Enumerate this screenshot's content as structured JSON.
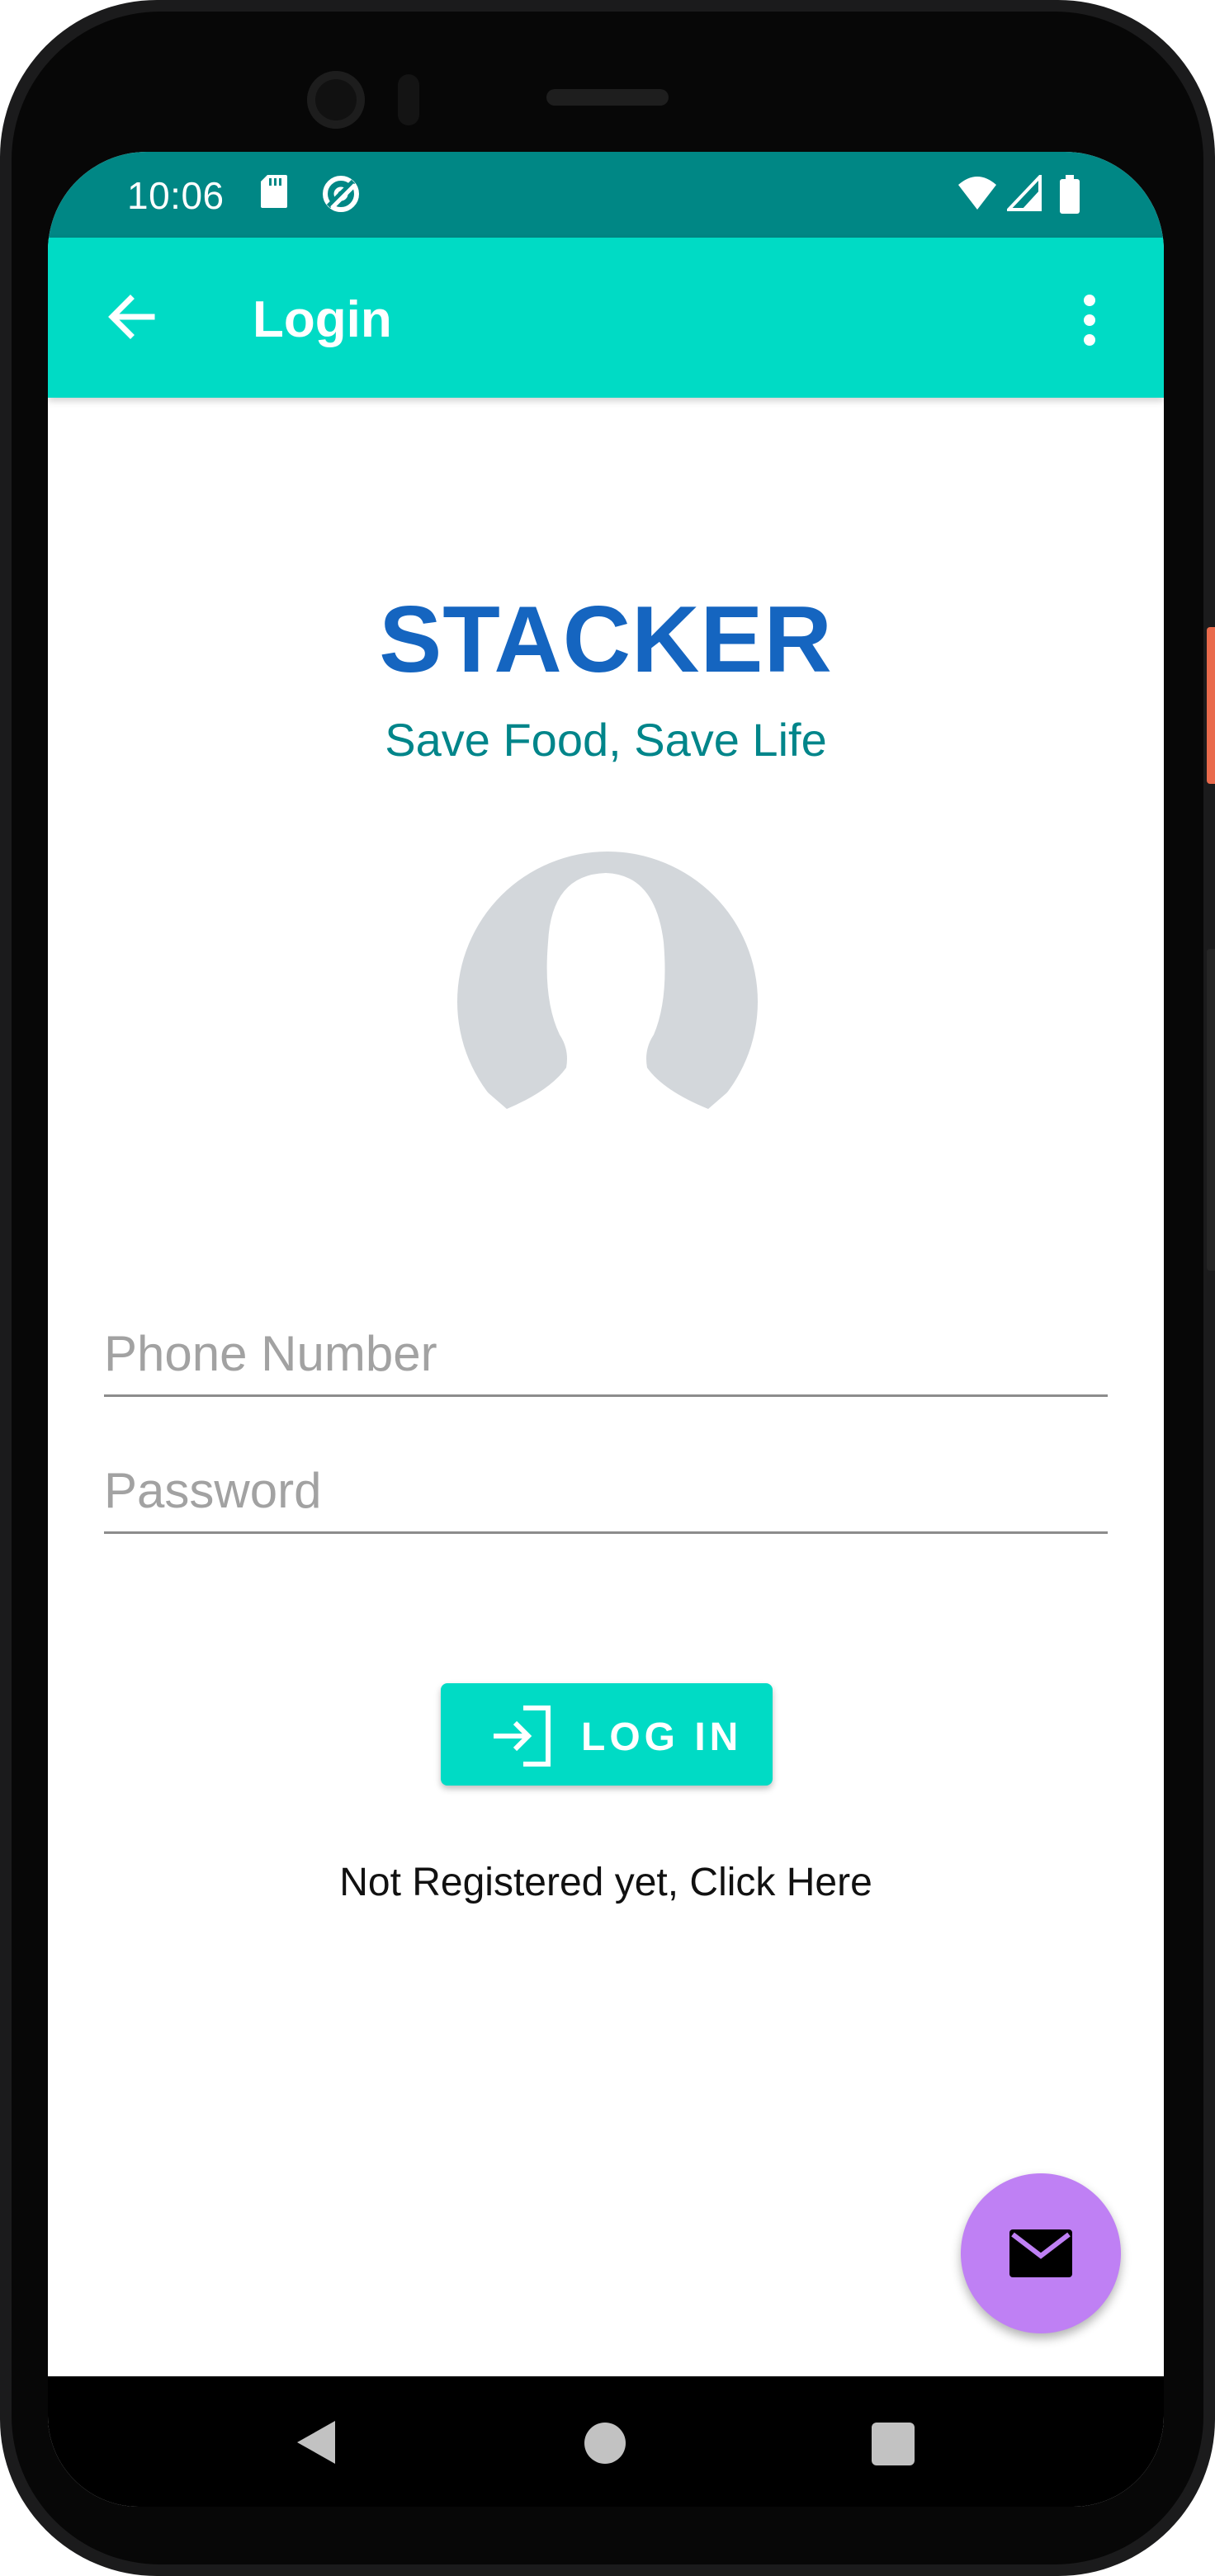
{
  "status_bar": {
    "time": "10:06",
    "left_icons": [
      "sd-card-icon",
      "data-saver-icon"
    ],
    "right_icons": [
      "wifi-icon",
      "cell-signal-icon",
      "battery-icon"
    ]
  },
  "app_bar": {
    "title": "Login",
    "back_icon": "arrow-back-icon",
    "menu_icon": "more-vert-icon"
  },
  "content": {
    "brand_title": "STACKER",
    "tagline": "Save Food, Save Life",
    "avatar_icon": "person-silhouette-icon",
    "phone_field": {
      "placeholder": "Phone Number",
      "value": ""
    },
    "password_field": {
      "placeholder": "Password",
      "value": ""
    },
    "login_button": {
      "label": "LOG IN",
      "icon": "login-icon"
    },
    "register_link": "Not Registered yet, Click Here",
    "fab": {
      "icon": "mail-icon"
    }
  },
  "nav_bar": {
    "items": [
      "nav-back-icon",
      "nav-home-icon",
      "nav-recents-icon"
    ]
  },
  "colors": {
    "status_bar": "#008785",
    "app_bar": "#00dbc5",
    "brand": "#1565c0",
    "tagline": "#00858a",
    "fab": "#bf80f4"
  }
}
